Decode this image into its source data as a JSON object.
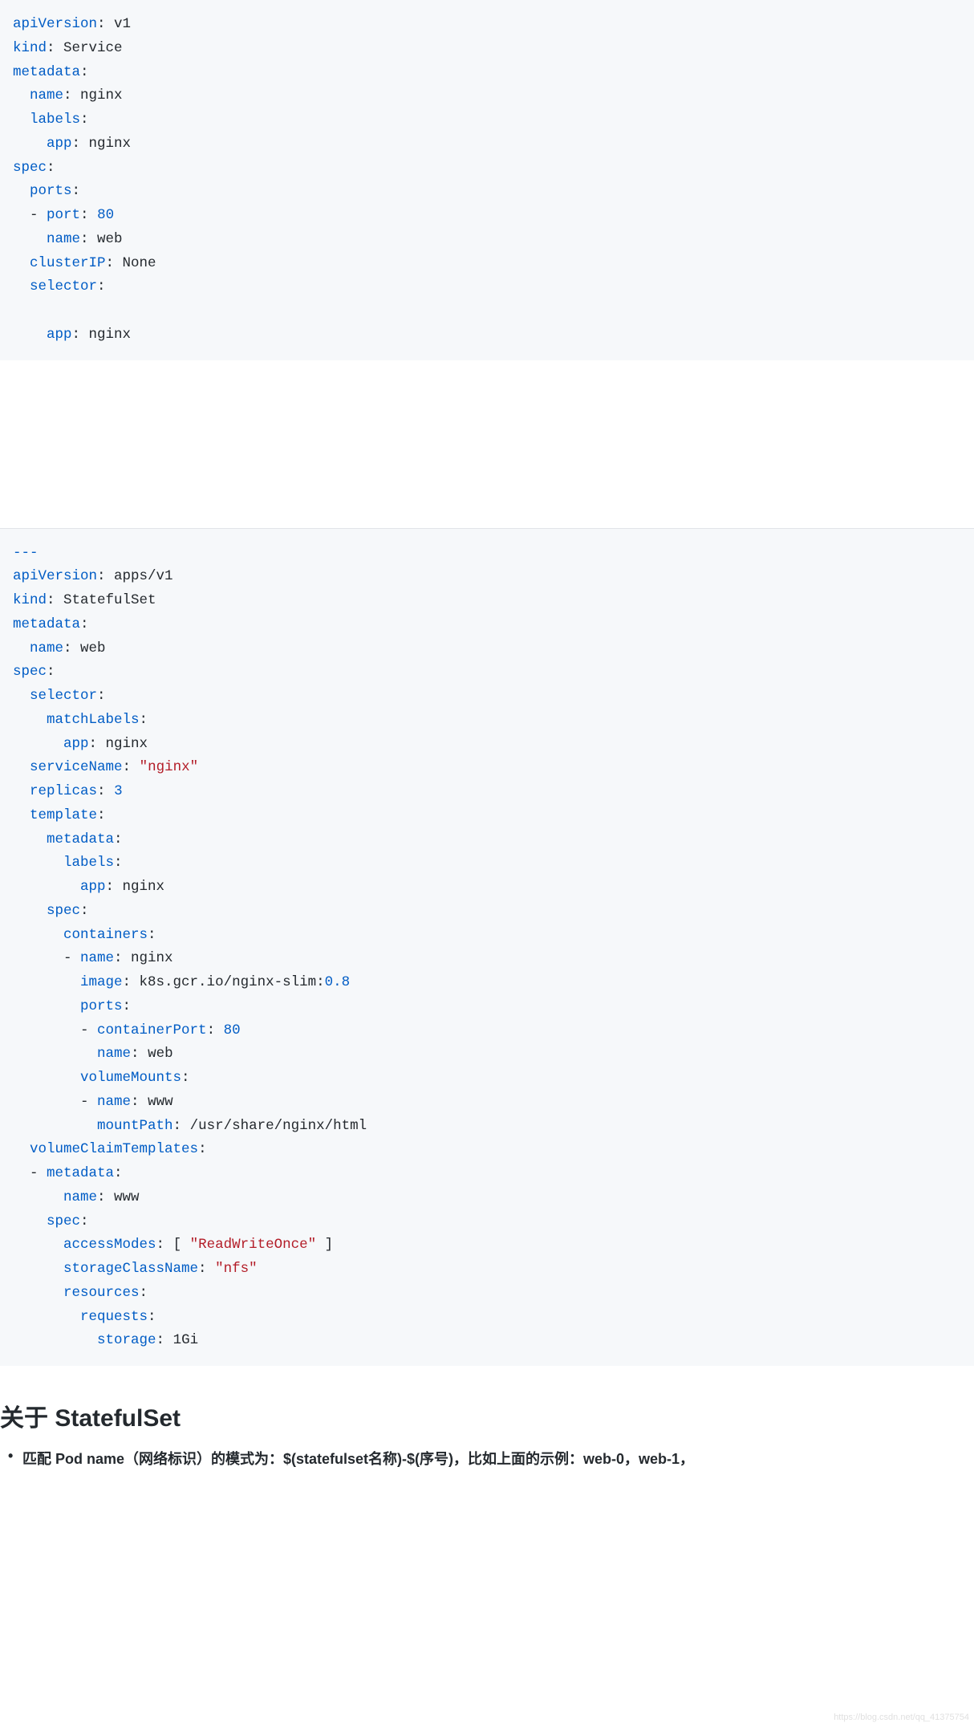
{
  "code1": {
    "lines": [
      [
        {
          "t": "apiVersion",
          "c": "k"
        },
        {
          "t": ":",
          "c": "d"
        },
        {
          "t": " v1",
          "c": "l"
        }
      ],
      [
        {
          "t": "kind",
          "c": "k"
        },
        {
          "t": ":",
          "c": "d"
        },
        {
          "t": " Service",
          "c": "l"
        }
      ],
      [
        {
          "t": "metadata",
          "c": "k"
        },
        {
          "t": ":",
          "c": "d"
        }
      ],
      [
        {
          "t": "  ",
          "c": "d"
        },
        {
          "t": "name",
          "c": "k"
        },
        {
          "t": ":",
          "c": "d"
        },
        {
          "t": " nginx",
          "c": "l"
        }
      ],
      [
        {
          "t": "  ",
          "c": "d"
        },
        {
          "t": "labels",
          "c": "k"
        },
        {
          "t": ":",
          "c": "d"
        }
      ],
      [
        {
          "t": "    ",
          "c": "d"
        },
        {
          "t": "app",
          "c": "k"
        },
        {
          "t": ":",
          "c": "d"
        },
        {
          "t": " nginx",
          "c": "l"
        }
      ],
      [
        {
          "t": "spec",
          "c": "k"
        },
        {
          "t": ":",
          "c": "d"
        }
      ],
      [
        {
          "t": "  ",
          "c": "d"
        },
        {
          "t": "ports",
          "c": "k"
        },
        {
          "t": ":",
          "c": "d"
        }
      ],
      [
        {
          "t": "  - ",
          "c": "d"
        },
        {
          "t": "port",
          "c": "k"
        },
        {
          "t": ":",
          "c": "d"
        },
        {
          "t": " ",
          "c": "d"
        },
        {
          "t": "80",
          "c": "n"
        }
      ],
      [
        {
          "t": "    ",
          "c": "d"
        },
        {
          "t": "name",
          "c": "k"
        },
        {
          "t": ":",
          "c": "d"
        },
        {
          "t": " web",
          "c": "l"
        }
      ],
      [
        {
          "t": "  ",
          "c": "d"
        },
        {
          "t": "clusterIP",
          "c": "k"
        },
        {
          "t": ":",
          "c": "d"
        },
        {
          "t": " None",
          "c": "l"
        }
      ],
      [
        {
          "t": "  ",
          "c": "d"
        },
        {
          "t": "selector",
          "c": "k"
        },
        {
          "t": ":",
          "c": "d"
        }
      ],
      [
        {
          "t": "",
          "c": "d"
        }
      ],
      [
        {
          "t": "    ",
          "c": "d"
        },
        {
          "t": "app",
          "c": "k"
        },
        {
          "t": ":",
          "c": "d"
        },
        {
          "t": " nginx",
          "c": "l"
        }
      ]
    ]
  },
  "code2": {
    "lines": [
      [
        {
          "t": "---",
          "c": "k"
        }
      ],
      [
        {
          "t": "apiVersion",
          "c": "k"
        },
        {
          "t": ":",
          "c": "d"
        },
        {
          "t": " apps/v1",
          "c": "l"
        }
      ],
      [
        {
          "t": "kind",
          "c": "k"
        },
        {
          "t": ":",
          "c": "d"
        },
        {
          "t": " StatefulSet",
          "c": "l"
        }
      ],
      [
        {
          "t": "metadata",
          "c": "k"
        },
        {
          "t": ":",
          "c": "d"
        }
      ],
      [
        {
          "t": "  ",
          "c": "d"
        },
        {
          "t": "name",
          "c": "k"
        },
        {
          "t": ":",
          "c": "d"
        },
        {
          "t": " web",
          "c": "l"
        }
      ],
      [
        {
          "t": "spec",
          "c": "k"
        },
        {
          "t": ":",
          "c": "d"
        }
      ],
      [
        {
          "t": "  ",
          "c": "d"
        },
        {
          "t": "selector",
          "c": "k"
        },
        {
          "t": ":",
          "c": "d"
        }
      ],
      [
        {
          "t": "    ",
          "c": "d"
        },
        {
          "t": "matchLabels",
          "c": "k"
        },
        {
          "t": ":",
          "c": "d"
        }
      ],
      [
        {
          "t": "      ",
          "c": "d"
        },
        {
          "t": "app",
          "c": "k"
        },
        {
          "t": ":",
          "c": "d"
        },
        {
          "t": " nginx",
          "c": "l"
        }
      ],
      [
        {
          "t": "  ",
          "c": "d"
        },
        {
          "t": "serviceName",
          "c": "k"
        },
        {
          "t": ":",
          "c": "d"
        },
        {
          "t": " ",
          "c": "d"
        },
        {
          "t": "\"nginx\"",
          "c": "s"
        }
      ],
      [
        {
          "t": "  ",
          "c": "d"
        },
        {
          "t": "replicas",
          "c": "k"
        },
        {
          "t": ":",
          "c": "d"
        },
        {
          "t": " ",
          "c": "d"
        },
        {
          "t": "3",
          "c": "n"
        }
      ],
      [
        {
          "t": "  ",
          "c": "d"
        },
        {
          "t": "template",
          "c": "k"
        },
        {
          "t": ":",
          "c": "d"
        }
      ],
      [
        {
          "t": "    ",
          "c": "d"
        },
        {
          "t": "metadata",
          "c": "k"
        },
        {
          "t": ":",
          "c": "d"
        }
      ],
      [
        {
          "t": "      ",
          "c": "d"
        },
        {
          "t": "labels",
          "c": "k"
        },
        {
          "t": ":",
          "c": "d"
        }
      ],
      [
        {
          "t": "        ",
          "c": "d"
        },
        {
          "t": "app",
          "c": "k"
        },
        {
          "t": ":",
          "c": "d"
        },
        {
          "t": " nginx",
          "c": "l"
        }
      ],
      [
        {
          "t": "    ",
          "c": "d"
        },
        {
          "t": "spec",
          "c": "k"
        },
        {
          "t": ":",
          "c": "d"
        }
      ],
      [
        {
          "t": "      ",
          "c": "d"
        },
        {
          "t": "containers",
          "c": "k"
        },
        {
          "t": ":",
          "c": "d"
        }
      ],
      [
        {
          "t": "      - ",
          "c": "d"
        },
        {
          "t": "name",
          "c": "k"
        },
        {
          "t": ":",
          "c": "d"
        },
        {
          "t": " nginx",
          "c": "l"
        }
      ],
      [
        {
          "t": "        ",
          "c": "d"
        },
        {
          "t": "image",
          "c": "k"
        },
        {
          "t": ":",
          "c": "d"
        },
        {
          "t": " k8s.gcr.io/nginx-slim:",
          "c": "l"
        },
        {
          "t": "0.8",
          "c": "n"
        }
      ],
      [
        {
          "t": "        ",
          "c": "d"
        },
        {
          "t": "ports",
          "c": "k"
        },
        {
          "t": ":",
          "c": "d"
        }
      ],
      [
        {
          "t": "        - ",
          "c": "d"
        },
        {
          "t": "containerPort",
          "c": "k"
        },
        {
          "t": ":",
          "c": "d"
        },
        {
          "t": " ",
          "c": "d"
        },
        {
          "t": "80",
          "c": "n"
        }
      ],
      [
        {
          "t": "          ",
          "c": "d"
        },
        {
          "t": "name",
          "c": "k"
        },
        {
          "t": ":",
          "c": "d"
        },
        {
          "t": " web",
          "c": "l"
        }
      ],
      [
        {
          "t": "        ",
          "c": "d"
        },
        {
          "t": "volumeMounts",
          "c": "k"
        },
        {
          "t": ":",
          "c": "d"
        }
      ],
      [
        {
          "t": "        - ",
          "c": "d"
        },
        {
          "t": "name",
          "c": "k"
        },
        {
          "t": ":",
          "c": "d"
        },
        {
          "t": " www",
          "c": "l"
        }
      ],
      [
        {
          "t": "          ",
          "c": "d"
        },
        {
          "t": "mountPath",
          "c": "k"
        },
        {
          "t": ":",
          "c": "d"
        },
        {
          "t": " /usr/share/nginx/html",
          "c": "l"
        }
      ],
      [
        {
          "t": "  ",
          "c": "d"
        },
        {
          "t": "volumeClaimTemplates",
          "c": "k"
        },
        {
          "t": ":",
          "c": "d"
        }
      ],
      [
        {
          "t": "  - ",
          "c": "d"
        },
        {
          "t": "metadata",
          "c": "k"
        },
        {
          "t": ":",
          "c": "d"
        }
      ],
      [
        {
          "t": "      ",
          "c": "d"
        },
        {
          "t": "name",
          "c": "k"
        },
        {
          "t": ":",
          "c": "d"
        },
        {
          "t": " www",
          "c": "l"
        }
      ],
      [
        {
          "t": "    ",
          "c": "d"
        },
        {
          "t": "spec",
          "c": "k"
        },
        {
          "t": ":",
          "c": "d"
        }
      ],
      [
        {
          "t": "      ",
          "c": "d"
        },
        {
          "t": "accessModes",
          "c": "k"
        },
        {
          "t": ":",
          "c": "d"
        },
        {
          "t": " [ ",
          "c": "d"
        },
        {
          "t": "\"ReadWriteOnce\"",
          "c": "s"
        },
        {
          "t": " ]",
          "c": "d"
        }
      ],
      [
        {
          "t": "      ",
          "c": "d"
        },
        {
          "t": "storageClassName",
          "c": "k"
        },
        {
          "t": ":",
          "c": "d"
        },
        {
          "t": " ",
          "c": "d"
        },
        {
          "t": "\"nfs\"",
          "c": "s"
        }
      ],
      [
        {
          "t": "      ",
          "c": "d"
        },
        {
          "t": "resources",
          "c": "k"
        },
        {
          "t": ":",
          "c": "d"
        }
      ],
      [
        {
          "t": "        ",
          "c": "d"
        },
        {
          "t": "requests",
          "c": "k"
        },
        {
          "t": ":",
          "c": "d"
        }
      ],
      [
        {
          "t": "          ",
          "c": "d"
        },
        {
          "t": "storage",
          "c": "k"
        },
        {
          "t": ":",
          "c": "d"
        },
        {
          "t": " 1Gi",
          "c": "l"
        }
      ]
    ]
  },
  "heading": "关于 StatefulSet",
  "bullet": "匹配 Pod name（网络标识）的模式为：$(statefulset名称)-$(序号)，比如上面的示例：web-0，web-1，",
  "watermark": "https://blog.csdn.net/qq_41375754"
}
